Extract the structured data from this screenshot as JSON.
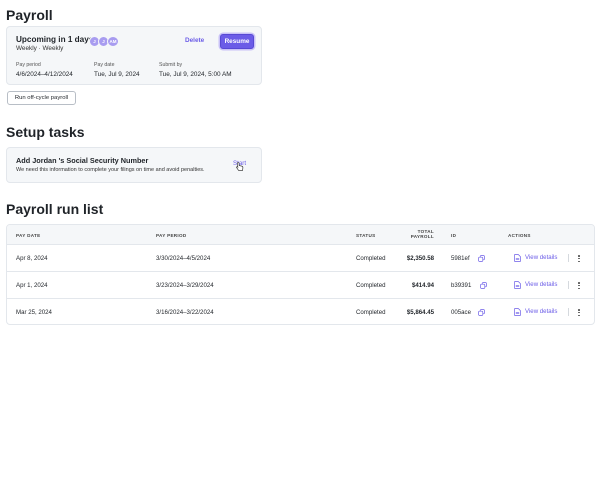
{
  "page": {
    "title": "Payroll",
    "setup_title": "Setup tasks",
    "runlist_title": "Payroll run list"
  },
  "upcoming": {
    "title": "Upcoming in 1 days",
    "subtitle": "Weekly · Weekly",
    "avatars": [
      "J",
      "J",
      "AM"
    ],
    "delete_label": "Delete",
    "resume_label": "Resume",
    "pay_period_label": "Pay period",
    "pay_period_value": "4/6/2024–4/12/2024",
    "pay_date_label": "Pay date",
    "pay_date_value": "Tue, Jul 9, 2024",
    "submit_by_label": "Submit by",
    "submit_by_value": "Tue, Jul 9, 2024, 5:00 AM"
  },
  "offcycle_label": "Run off-cycle payroll",
  "task": {
    "title": "Add Jordan 's Social Security Number",
    "description": "We need this information to complete your filings on time and avoid penalties.",
    "start_label": "Start"
  },
  "table": {
    "headers": {
      "pay_date": "PAY DATE",
      "pay_period": "PAY PERIOD",
      "status": "STATUS",
      "total_payroll_1": "TOTAL",
      "total_payroll_2": "PAYROLL",
      "id": "ID",
      "actions": "ACTIONS"
    },
    "rows": [
      {
        "pay_date": "Apr 8, 2024",
        "pay_period": "3/30/2024–4/5/2024",
        "status": "Completed",
        "total": "$2,350.58",
        "id": "5981ef",
        "action": "View details"
      },
      {
        "pay_date": "Apr 1, 2024",
        "pay_period": "3/23/2024–3/29/2024",
        "status": "Completed",
        "total": "$414.94",
        "id": "b39391",
        "action": "View details"
      },
      {
        "pay_date": "Mar 25, 2024",
        "pay_period": "3/16/2024–3/22/2024",
        "status": "Completed",
        "total": "$5,864.45",
        "id": "005ace",
        "action": "View details"
      }
    ]
  },
  "colors": {
    "accent": "#6b5ce7",
    "card_bg": "#f5f7f9",
    "border": "#e3e7ec"
  },
  "icons": {
    "copy": "copy-icon",
    "document": "document-icon",
    "more": "more-vertical-icon",
    "cursor": "cursor-pointer-icon"
  }
}
